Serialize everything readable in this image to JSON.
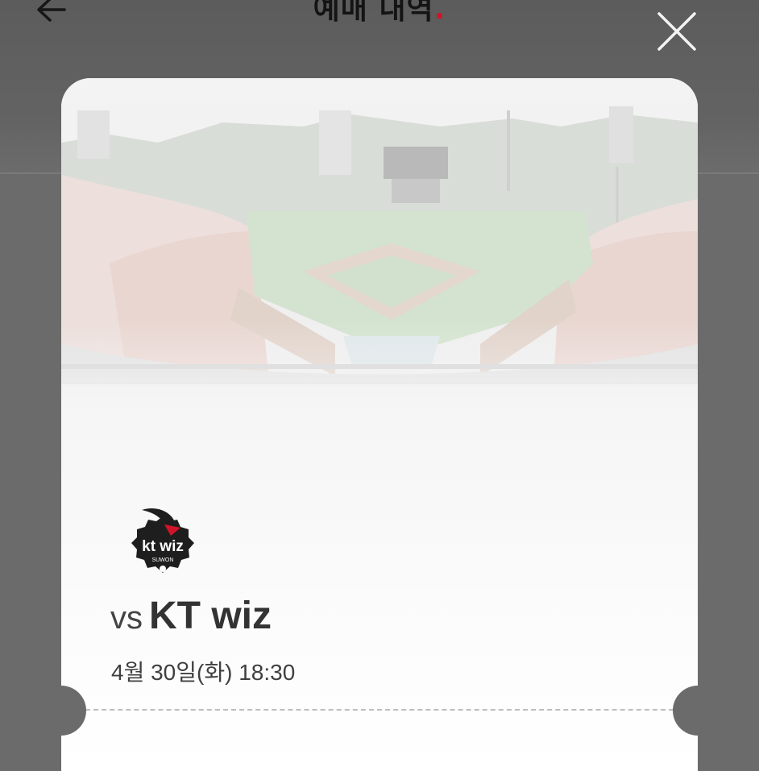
{
  "header": {
    "title": "예매 내역",
    "title_dot": ".",
    "back_icon": "arrow-left-icon",
    "close_icon": "close-icon"
  },
  "ticket": {
    "team_logo": {
      "wordmark": "kt wiz",
      "subtext": "SUWON"
    },
    "vs_label": "vs",
    "opponent_name": "KT wiz",
    "game_datetime": "4월 30일(화) 18:30"
  },
  "colors": {
    "accent_dot": "#d0152a",
    "overlay": "#6b6b6b",
    "ticket_background": "#ffffff"
  }
}
